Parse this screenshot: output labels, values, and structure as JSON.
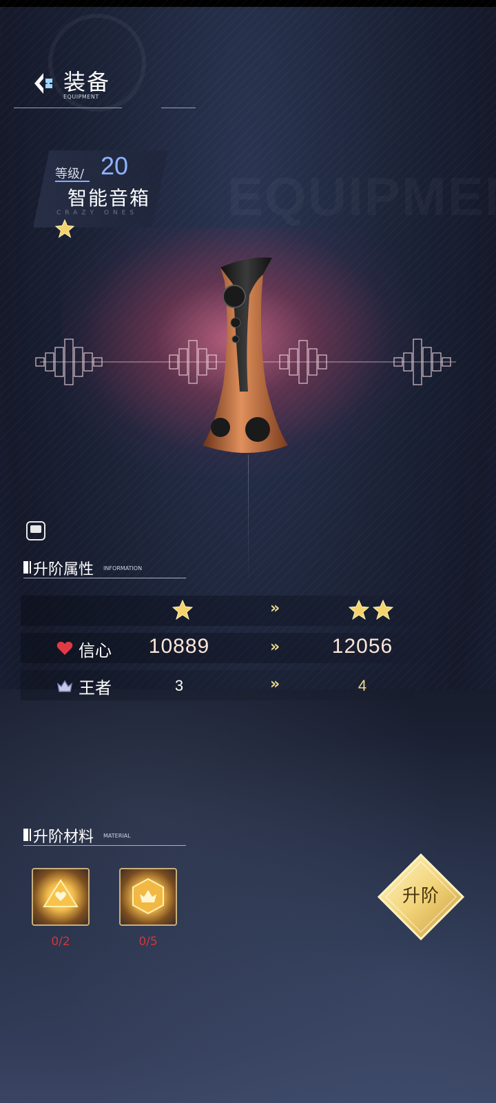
{
  "header": {
    "title": "装备",
    "subtitle": "EQUIPMENT"
  },
  "background": {
    "watermark": "EQUIPMENT"
  },
  "item": {
    "level_label": "等级/",
    "level": "20",
    "name": "智能音箱",
    "name_sub": "CRAZY ONES",
    "stars": 1,
    "image": "smart-speaker-icon"
  },
  "upgrade_attributes": {
    "title": "升阶属性",
    "subtitle": "INFORMATION",
    "current_stars": 1,
    "next_stars": 2,
    "arrow": "»",
    "rows": [
      {
        "icon": "heart-icon",
        "name": "信心",
        "current": "10889",
        "next": "12056"
      },
      {
        "icon": "crown-icon",
        "name": "王者",
        "current": "3",
        "next": "4"
      }
    ]
  },
  "materials": {
    "title": "升阶材料",
    "subtitle": "MATERIAL",
    "items": [
      {
        "icon": "heart-gem-icon",
        "count": "0/2"
      },
      {
        "icon": "crown-gem-icon",
        "count": "0/5"
      }
    ]
  },
  "actions": {
    "upgrade_label": "升阶"
  },
  "colors": {
    "level_blue": "#8fb2ff",
    "gold": "#f2d98a",
    "count_red": "#d2363a",
    "heart_red": "#e23a44"
  }
}
